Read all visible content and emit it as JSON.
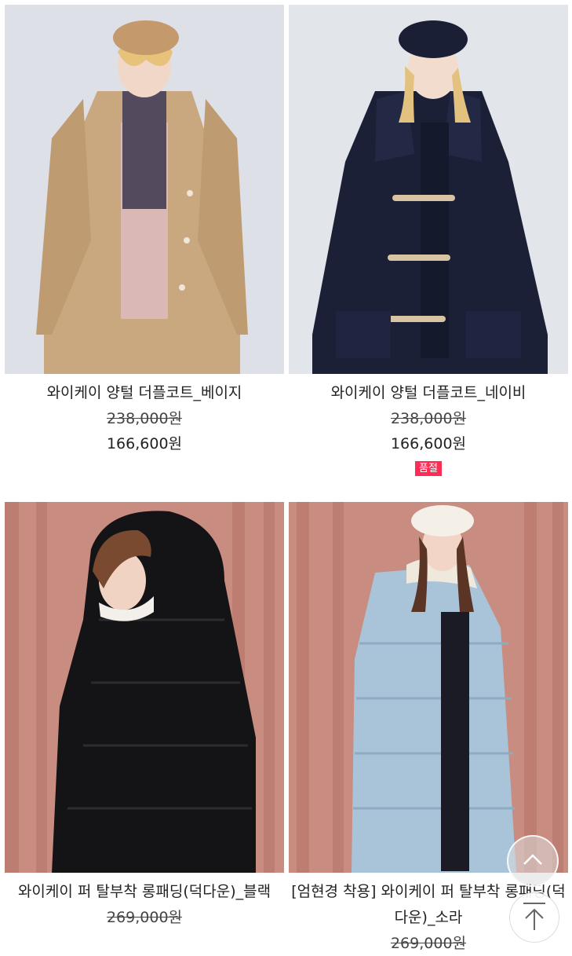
{
  "products": [
    {
      "name": "와이케이 양털 더플코트_베이지",
      "original_price": "238,000원",
      "sale_price": "166,600원",
      "badge": ""
    },
    {
      "name": "와이케이 양털 더플코트_네이비",
      "original_price": "238,000원",
      "sale_price": "166,600원",
      "badge": "품절"
    },
    {
      "name": "와이케이 퍼 탈부착 롱패딩(덕다운)_블랙",
      "original_price": "269,000원",
      "sale_price": "",
      "badge": ""
    },
    {
      "name": "[엄현경 착용] 와이케이 퍼 탈부착 롱패딩(덕다운)_소라",
      "original_price": "269,000원",
      "sale_price": "",
      "badge": ""
    }
  ],
  "colors": {
    "badge_sold_out": "#ff2d55",
    "sale_text": "#222222"
  },
  "icons": {
    "scroll_up": "chevron-up-icon",
    "scroll_top": "arrow-up-to-top-icon"
  }
}
